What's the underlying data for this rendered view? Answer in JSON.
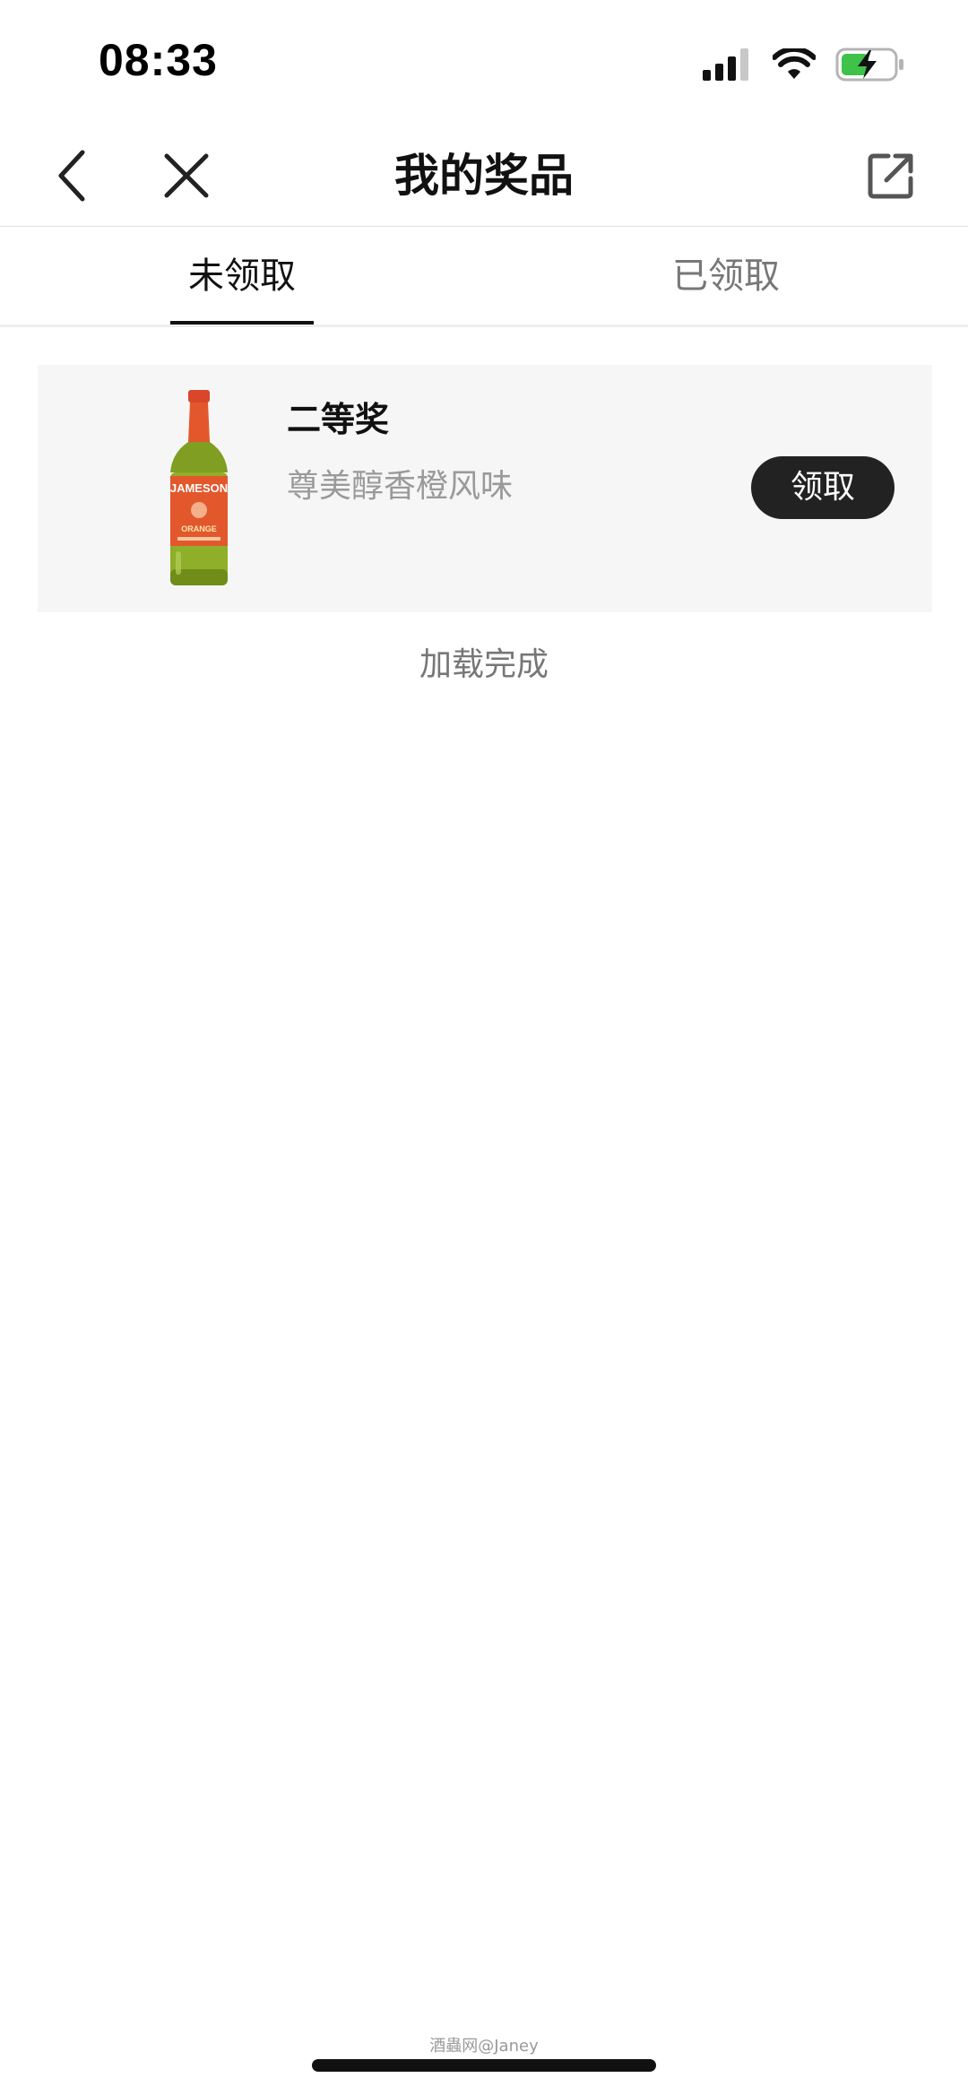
{
  "status_bar": {
    "time": "08:33",
    "icons": [
      "signal-icon",
      "wifi-icon",
      "battery-charging-icon"
    ]
  },
  "nav": {
    "title": "我的奖品",
    "icons": [
      "chevron-left-icon",
      "close-icon",
      "share-icon"
    ]
  },
  "tabs": [
    {
      "label": "未领取",
      "active": true
    },
    {
      "label": "已领取",
      "active": false
    }
  ],
  "prizes": [
    {
      "level": "二等奖",
      "name": "尊美醇香橙风味",
      "action_label": "领取",
      "image_icon": "liquor-bottle-image",
      "bottle_label": "JAMESON",
      "bottle_sublabel": "ORANGE"
    }
  ],
  "list_status": "加载完成",
  "watermark": "酒蟲网@Janey",
  "colors": {
    "accent": "#222222",
    "card_bg": "#f6f6f6",
    "muted_text": "#9a9a9a",
    "bottle_green": "#8fae2a",
    "bottle_label": "#e3572c"
  }
}
